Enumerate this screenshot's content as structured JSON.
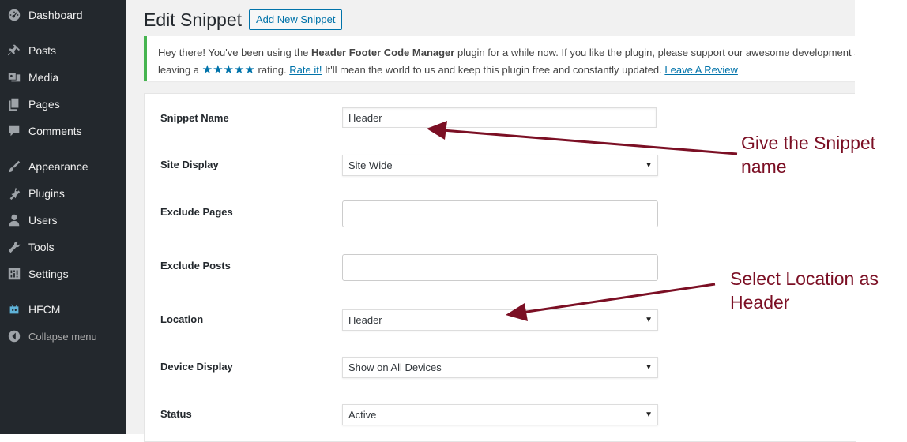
{
  "sidebar": {
    "items": [
      {
        "label": "Dashboard",
        "icon": "dashboard-icon"
      },
      {
        "label": "Posts",
        "icon": "pin-icon"
      },
      {
        "label": "Media",
        "icon": "media-icon"
      },
      {
        "label": "Pages",
        "icon": "pages-icon"
      },
      {
        "label": "Comments",
        "icon": "comments-icon"
      },
      {
        "label": "Appearance",
        "icon": "brush-icon"
      },
      {
        "label": "Plugins",
        "icon": "plugin-icon"
      },
      {
        "label": "Users",
        "icon": "user-icon"
      },
      {
        "label": "Tools",
        "icon": "wrench-icon"
      },
      {
        "label": "Settings",
        "icon": "settings-icon"
      },
      {
        "label": "HFCM",
        "icon": "robot-icon"
      },
      {
        "label": "Collapse menu",
        "icon": "collapse-icon"
      }
    ]
  },
  "header": {
    "title": "Edit Snippet",
    "add_new_label": "Add New Snippet"
  },
  "notice": {
    "line1_prefix": "Hey there! You've been using the ",
    "plugin_name": "Header Footer Code Manager",
    "line1_suffix": " plugin for a while now. If you like the plugin, please support our awesome development a",
    "line2_prefix": "leaving a ",
    "stars": "★★★★★",
    "line2_rating": " rating. ",
    "rate_link": "Rate it!",
    "line2_middle": " It'll mean the world to us and keep this plugin free and constantly updated. ",
    "review_link": "Leave A Review"
  },
  "form": {
    "snippet_name_label": "Snippet Name",
    "snippet_name_value": "Header",
    "site_display_label": "Site Display",
    "site_display_value": "Site Wide",
    "exclude_pages_label": "Exclude Pages",
    "exclude_posts_label": "Exclude Posts",
    "location_label": "Location",
    "location_value": "Header",
    "device_display_label": "Device Display",
    "device_display_value": "Show on All Devices",
    "status_label": "Status",
    "status_value": "Active",
    "arrow_glyph": "▼"
  },
  "annotations": {
    "name_line1": "Give the Snippet",
    "name_line2": "name",
    "location_line1": "Select Location as",
    "location_line2": "Header",
    "color": "#7b0f24"
  },
  "colors": {
    "sidebar_bg": "#23282d",
    "accent": "#0073aa",
    "notice_border": "#46b450"
  }
}
